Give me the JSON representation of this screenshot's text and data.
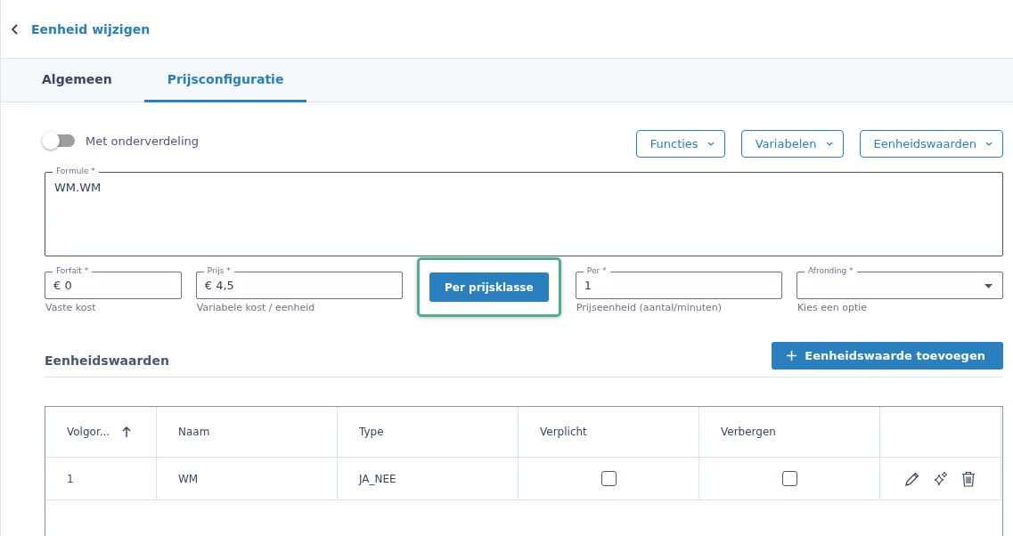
{
  "header": {
    "title": "Eenheid wijzigen"
  },
  "tabs": [
    {
      "label": "Algemeen",
      "selected": false
    },
    {
      "label": "Prijsconfiguratie",
      "selected": true
    }
  ],
  "toggle": {
    "label": "Met onderverdeling",
    "on": false
  },
  "menus": [
    "Functies",
    "Variabelen",
    "Eenheidswaarden"
  ],
  "formula": {
    "label": "Formule *",
    "value": "WM.WM"
  },
  "fields": [
    {
      "kind": "input",
      "label": "Forfait *",
      "value": "€ 0",
      "hint": "Vaste kost"
    },
    {
      "kind": "input",
      "label": "Prijs *",
      "value": "€ 4,5",
      "hint": "Variabele kost / eenheid"
    },
    {
      "kind": "button",
      "label": "Per prijsklasse",
      "highlighted": true
    },
    {
      "kind": "input",
      "label": "Per *",
      "value": "1",
      "hint": "Prijseenheid (aantal/minuten)"
    },
    {
      "kind": "select",
      "label": "Afronding *",
      "hint": "Kies een optie"
    }
  ],
  "section": {
    "title": "Eenheidswaarden",
    "add_button": "Eenheidswaarde toevoegen"
  },
  "table": {
    "columns": [
      {
        "label": "Volgor...",
        "sorted": true
      },
      {
        "label": "Naam",
        "sorted": false
      },
      {
        "label": "Type",
        "sorted": false
      },
      {
        "label": "Verplicht",
        "sorted": false
      },
      {
        "label": "Verbergen",
        "sorted": false
      }
    ],
    "rows": [
      {
        "order": "1",
        "name": "WM",
        "type": "JA_NEE",
        "required": false,
        "hidden": false
      }
    ]
  }
}
